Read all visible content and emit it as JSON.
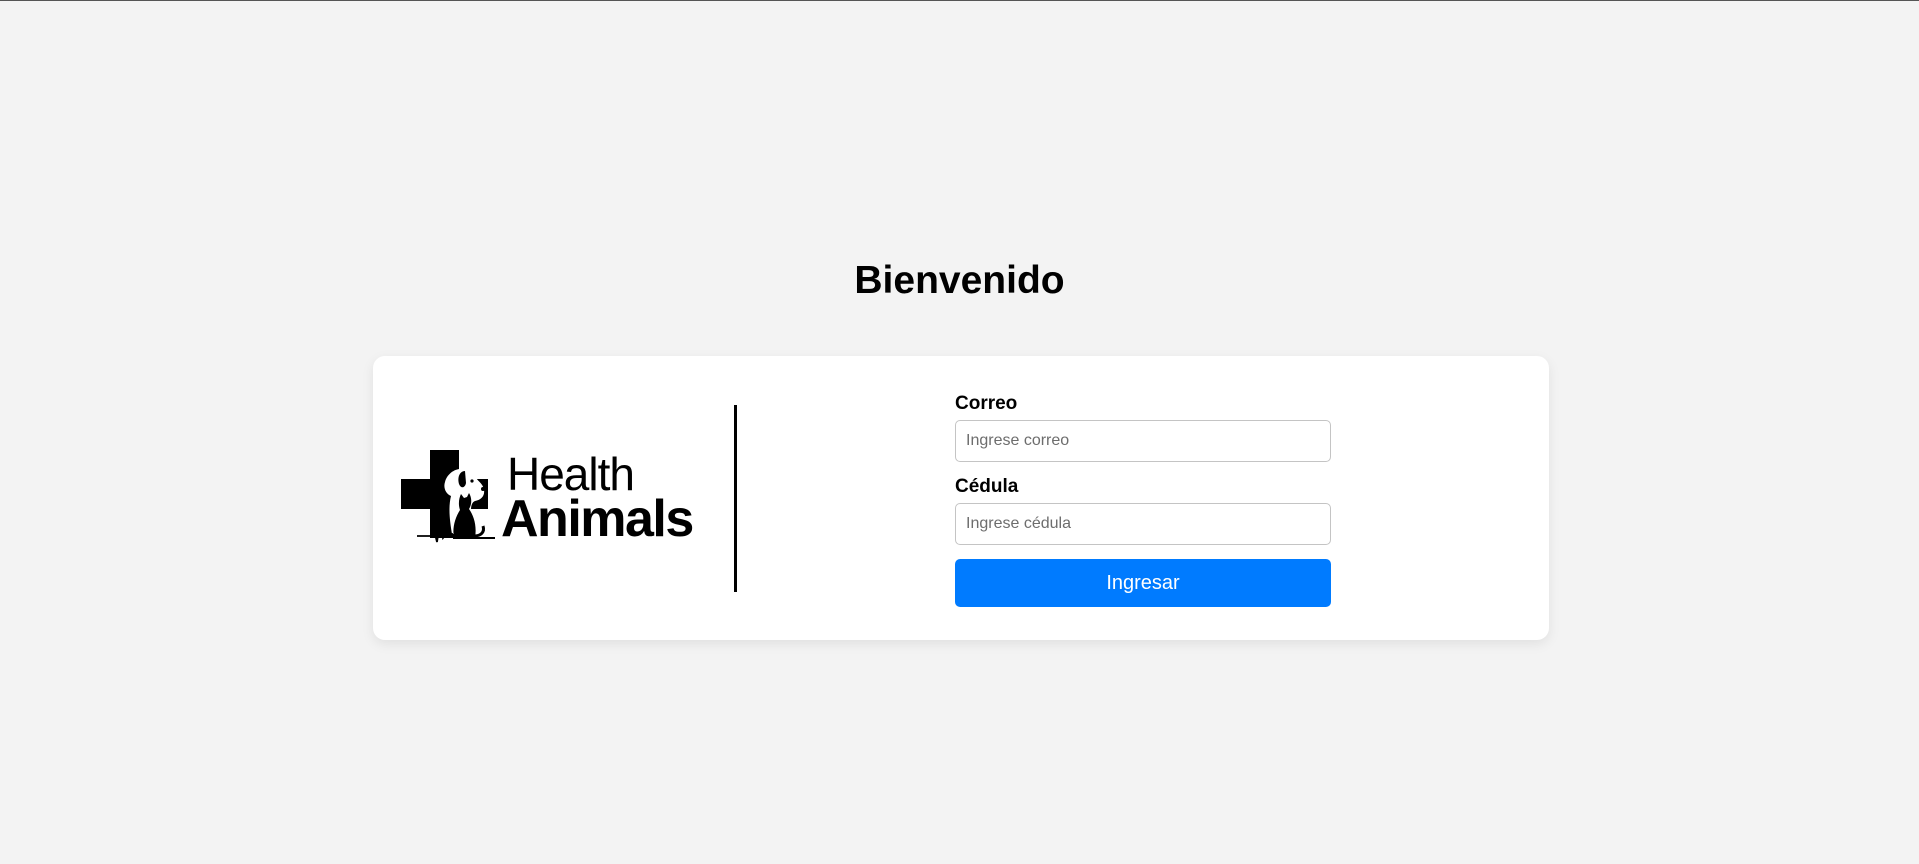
{
  "page": {
    "title": "Bienvenido"
  },
  "logo": {
    "line1": "Health",
    "line2": "Animals"
  },
  "form": {
    "email_label": "Correo",
    "email_placeholder": "Ingrese correo",
    "email_value": "",
    "id_label": "Cédula",
    "id_placeholder": "Ingrese cédula",
    "id_value": "",
    "submit_label": "Ingresar"
  },
  "colors": {
    "background": "#f3f3f3",
    "card": "#ffffff",
    "primary_button": "#007bff",
    "button_text": "#ffffff"
  }
}
